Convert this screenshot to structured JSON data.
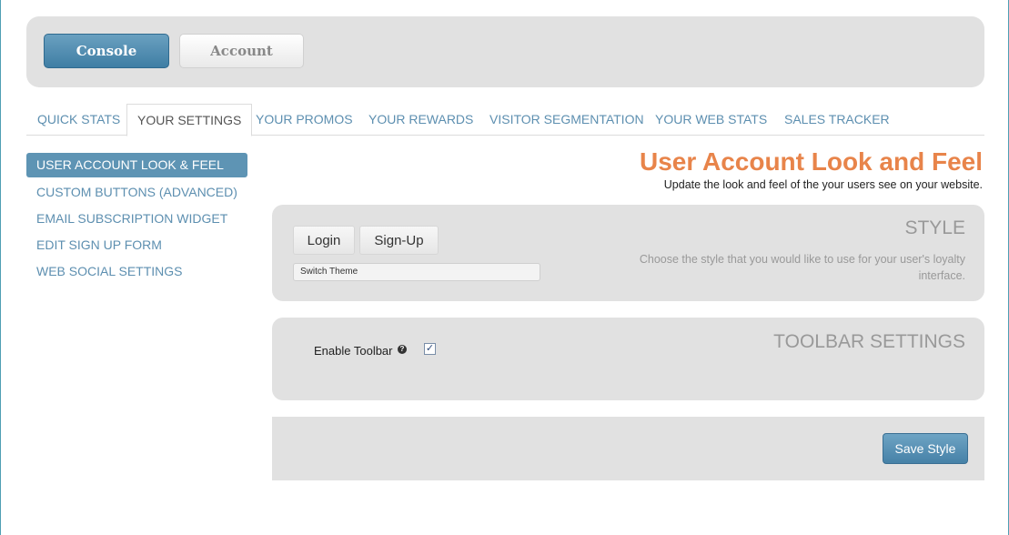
{
  "top_nav": {
    "console_label": "Console",
    "account_label": "Account"
  },
  "tabs": [
    {
      "label": "QUICK STATS"
    },
    {
      "label": "YOUR SETTINGS",
      "active": true
    },
    {
      "label": "YOUR PROMOS"
    },
    {
      "label": "YOUR REWARDS"
    },
    {
      "label": "VISITOR SEGMENTATION"
    },
    {
      "label": "YOUR WEB STATS"
    },
    {
      "label": "SALES TRACKER"
    }
  ],
  "sidebar": {
    "items": [
      {
        "label": "USER ACCOUNT LOOK & FEEL",
        "active": true
      },
      {
        "label": "CUSTOM BUTTONS (ADVANCED)"
      },
      {
        "label": "EMAIL SUBSCRIPTION WIDGET"
      },
      {
        "label": "EDIT SIGN UP FORM"
      },
      {
        "label": "WEB SOCIAL SETTINGS"
      }
    ]
  },
  "main": {
    "title": "User Account Look and Feel",
    "subtitle": "Update the look and feel of the your users see on your website."
  },
  "style_panel": {
    "heading": "STYLE",
    "login_label": "Login",
    "signup_label": "Sign-Up",
    "theme_select_value": "Switch Theme",
    "description": "Choose the style that you would like to use for your user's loyalty interface."
  },
  "toolbar_panel": {
    "heading": "TOOLBAR SETTINGS",
    "enable_label": "Enable Toolbar",
    "help_glyph": "?",
    "checkbox_glyph": "✓",
    "enabled": true
  },
  "save": {
    "label": "Save Style"
  },
  "colors": {
    "accent_blue": "#5e94b4",
    "title_orange": "#e8844a",
    "panel_gray": "#e1e1e1",
    "link_blue": "#5d8fb0"
  }
}
